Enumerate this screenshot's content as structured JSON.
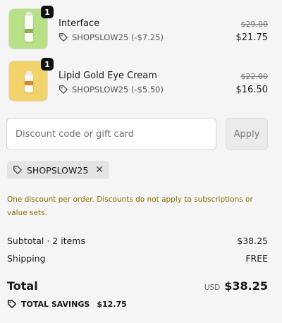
{
  "items": [
    {
      "quantity": "1",
      "name": "Interface",
      "discount_code": "SHOPSLOW25 (-$7.25)",
      "original_price": "$29.00",
      "price": "$21.75"
    },
    {
      "quantity": "1",
      "name": "Lipid Gold Eye Cream",
      "discount_code": "SHOPSLOW25 (-$5.50)",
      "original_price": "$22.00",
      "price": "$16.50"
    }
  ],
  "discount": {
    "placeholder": "Discount code or gift card",
    "value": "",
    "apply_label": "Apply",
    "applied_code": "SHOPSLOW25",
    "notice": "One discount per order. Discounts do not apply to subscriptions or value sets."
  },
  "summary": {
    "subtotal_label": "Subtotal · 2 items",
    "subtotal_value": "$38.25",
    "shipping_label": "Shipping",
    "shipping_value": "FREE",
    "total_label": "Total",
    "currency": "USD",
    "total_value": "$38.25",
    "savings_label": "TOTAL SAVINGS",
    "savings_value": "$12.75"
  },
  "colors": {
    "notice": "#8a6d00",
    "thumb_1": "#b7e087",
    "thumb_2": "#f2d36b"
  },
  "icons": [
    "tag-icon",
    "close-icon"
  ]
}
